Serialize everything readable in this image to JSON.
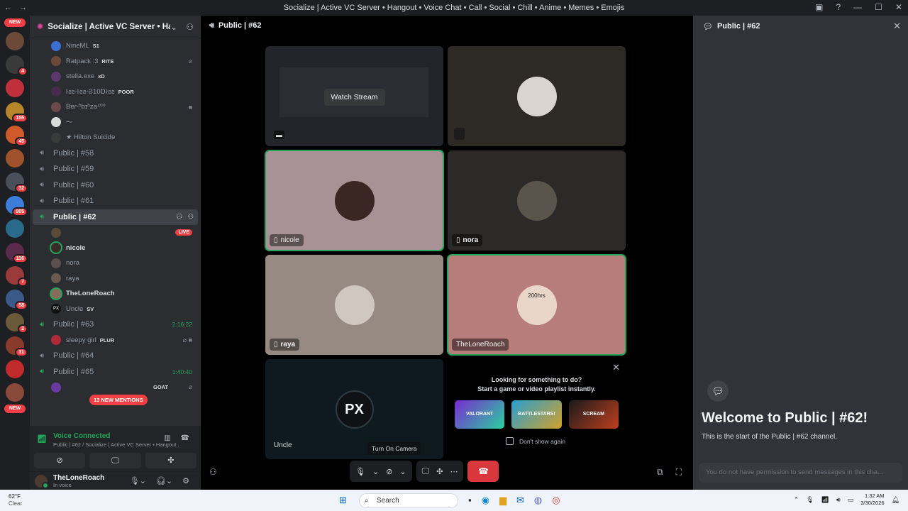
{
  "window": {
    "title": "Socialize | Active VC Server • Hangout • Voice Chat • Call • Social • Chill • Anime • Memes • Emojis"
  },
  "rail": {
    "new_top": "NEW",
    "new_bottom": "NEW",
    "badges": [
      "4",
      "155",
      "45",
      "32",
      "905",
      "116",
      "7",
      "58",
      "2",
      "31"
    ]
  },
  "server": {
    "name": "Socialize | Active VC Server • Han..."
  },
  "voice_users_top": [
    {
      "name": "NineML",
      "tag": "S1"
    },
    {
      "name": "Ratpack :3",
      "tag": "RITE"
    },
    {
      "name": "stella.exe",
      "tag": "xD"
    },
    {
      "name": "ŀƨƨ-ŀƨƨ-Ƨ10Ɒŀƨƨ",
      "tag": "POOR"
    },
    {
      "name": "Bɐɾ-ʰbɪʰza⁴⁰⁰",
      "tag": ""
    },
    {
      "name": "⁓",
      "tag": ""
    },
    {
      "name": "★ Hilton Suicide",
      "tag": ""
    }
  ],
  "channels_before": [
    "Public | #58",
    "Public | #59",
    "Public | #60",
    "Public | #61"
  ],
  "active_channel": {
    "name": "Public | #62",
    "live": "LIVE",
    "users": [
      {
        "name": "",
        "tag": ""
      },
      {
        "name": "nicole",
        "tag": ""
      },
      {
        "name": "nora",
        "tag": ""
      },
      {
        "name": "raya",
        "tag": ""
      },
      {
        "name": "TheLoneRoach",
        "tag": ""
      },
      {
        "name": "Uncle",
        "tag": "SV"
      }
    ]
  },
  "channel_63": {
    "name": "Public | #63",
    "timer": "2:16:22",
    "user": "sleepy girl",
    "tag": "PLUR"
  },
  "channel_64": {
    "name": "Public | #64"
  },
  "channel_65": {
    "name": "Public | #65",
    "timer": "1:40:40",
    "tag": "GOAT"
  },
  "mentions": "13 NEW MENTIONS",
  "voice_panel": {
    "status": "Voice Connected",
    "location": "Public | #62 / Socialize | Active VC Server • Hangout..."
  },
  "user": {
    "name": "TheLoneRoach",
    "status": "In voice"
  },
  "stage": {
    "header": "Public | #62",
    "watch_stream": "Watch Stream",
    "tiles": {
      "nicole": "nicole",
      "nora": "nora",
      "raya": "raya",
      "roach": "TheLoneRoach",
      "uncle": "Uncle"
    },
    "roach_avatar_text": "200hrs",
    "px_logo": "PX",
    "promo": {
      "line1": "Looking for something to do?",
      "line2": "Start a game or video playlist instantly.",
      "games": [
        "VALORANT",
        "BATTLESTARS!",
        "SCREAM"
      ],
      "dont_show": "Don't show again"
    },
    "tooltip": "Turn On Camera"
  },
  "chat": {
    "header": "Public | #62",
    "welcome": "Welcome to Public | #62!",
    "subtitle": "This is the start of the Public | #62 channel.",
    "input_placeholder": "You do not have permission to send messages in this cha..."
  },
  "taskbar": {
    "temp": "62°F",
    "weather": "Clear",
    "search": "Search",
    "time": "1:32 AM",
    "date": "3/30/2026"
  }
}
